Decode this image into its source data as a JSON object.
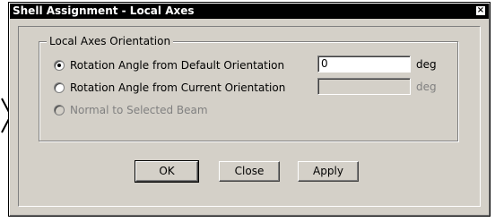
{
  "window": {
    "title": "Shell Assignment - Local Axes",
    "close_glyph": "×"
  },
  "group": {
    "legend": "Local Axes Orientation",
    "options": [
      {
        "label": "Rotation Angle from Default Orientation",
        "selected": true,
        "enabled": true
      },
      {
        "label": "Rotation Angle from Current Orientation",
        "selected": false,
        "enabled": false
      },
      {
        "label": "Normal to Selected Beam",
        "selected": false,
        "enabled": false
      }
    ],
    "default_angle": {
      "value": "0",
      "unit": "deg"
    },
    "current_angle": {
      "value": "",
      "unit": "deg"
    }
  },
  "buttons": {
    "ok": "OK",
    "close": "Close",
    "apply": "Apply"
  },
  "icons": {
    "left_edge": "chevron-right-icon"
  }
}
